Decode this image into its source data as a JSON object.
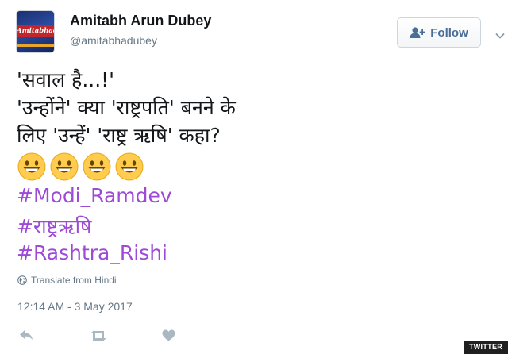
{
  "user": {
    "display_name": "Amitabh Arun Dubey",
    "handle": "@amitabhadubey",
    "avatar_text": "Amitabhadu"
  },
  "follow_button": {
    "label": "Follow",
    "icon": "add-user-icon"
  },
  "tweet": {
    "lines": [
      "'सवाल है...!'",
      "'उन्होंने' क्या 'राष्ट्रपति' बनने के",
      "लिए 'उन्हें' 'राष्ट्र ऋषि' कहा?"
    ],
    "emoji_count": 4,
    "hashtags": [
      "#Modi_Ramdev",
      "#राष्ट्रऋषि",
      "#Rashtra_Rishi"
    ]
  },
  "translate": {
    "label": "Translate from Hindi",
    "icon": "globe-icon"
  },
  "timestamp": "12:14 AM - 3 May 2017",
  "actions": [
    "reply-icon",
    "retweet-icon",
    "like-icon"
  ],
  "watermark": "TWITTER",
  "colors": {
    "hashtag": "#9d4bd6",
    "follow_text": "#4a6e9a",
    "meta_text": "#657786",
    "action_icons": "#aab8c2"
  }
}
